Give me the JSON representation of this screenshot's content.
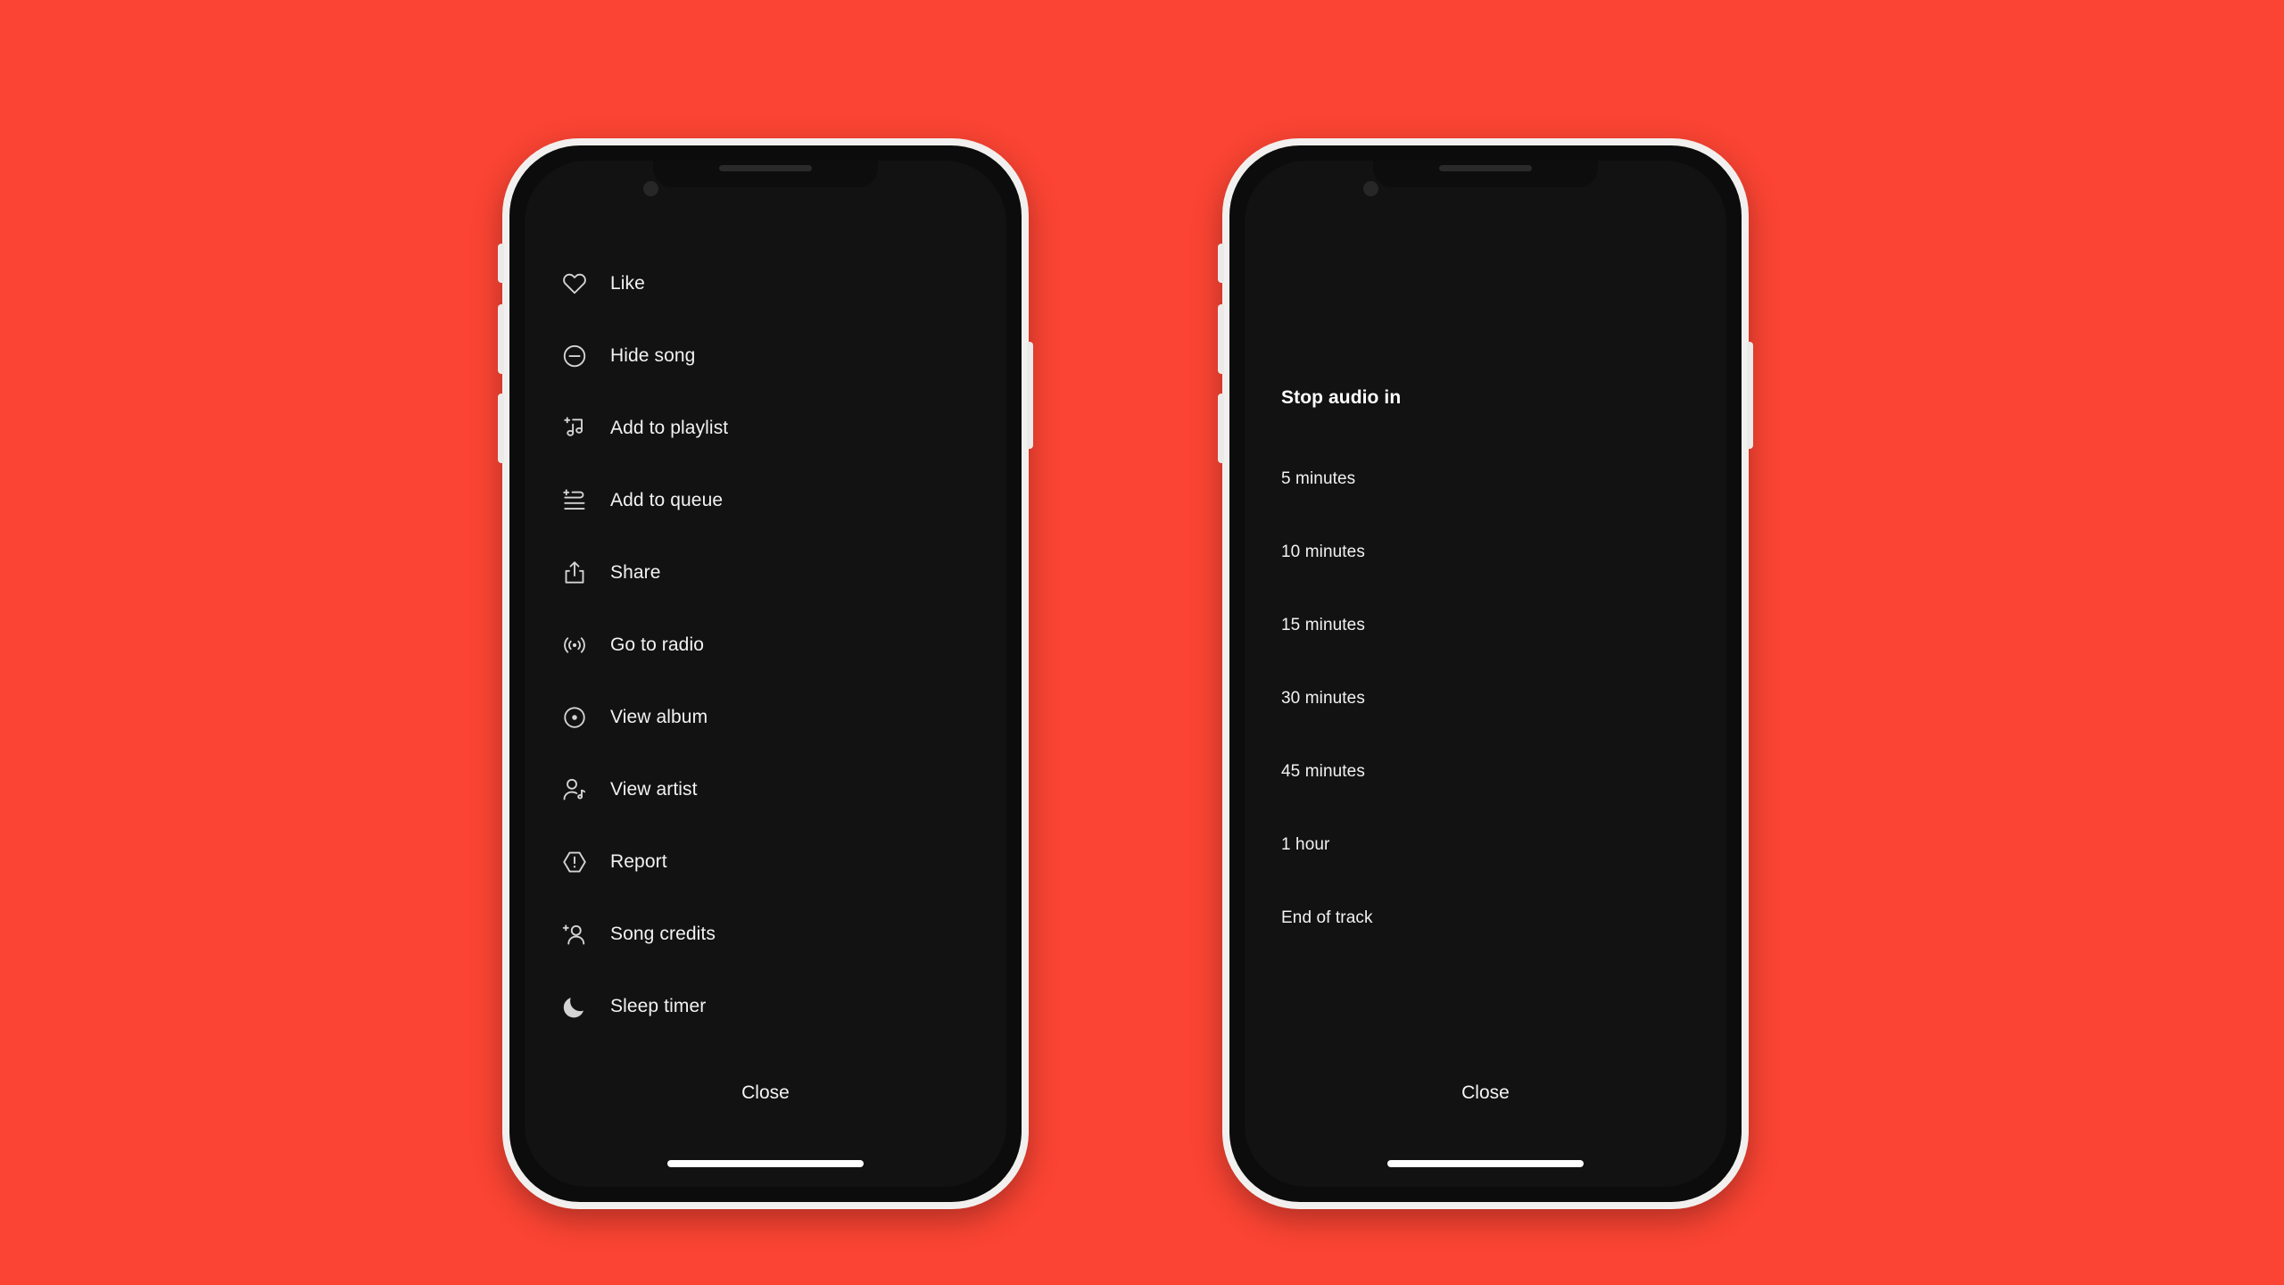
{
  "theme": {
    "background_color": "#fb4433",
    "screen_color": "#121212",
    "frame_color": "#f2f0ee",
    "text_color": "#f2f2f2"
  },
  "left_phone": {
    "menu": {
      "items": [
        {
          "label": "Like",
          "icon": "heart-icon"
        },
        {
          "label": "Hide song",
          "icon": "minus-circle-icon"
        },
        {
          "label": "Add to playlist",
          "icon": "music-note-plus-icon"
        },
        {
          "label": "Add to queue",
          "icon": "queue-plus-icon"
        },
        {
          "label": "Share",
          "icon": "share-icon"
        },
        {
          "label": "Go to radio",
          "icon": "radio-waves-icon"
        },
        {
          "label": "View album",
          "icon": "album-disc-icon"
        },
        {
          "label": "View artist",
          "icon": "artist-icon"
        },
        {
          "label": "Report",
          "icon": "report-octagon-icon"
        },
        {
          "label": "Song credits",
          "icon": "person-plus-icon"
        },
        {
          "label": "Sleep timer",
          "icon": "moon-icon"
        }
      ]
    },
    "close_label": "Close"
  },
  "right_phone": {
    "sleep_timer": {
      "title": "Stop audio in",
      "options": [
        {
          "label": "5 minutes"
        },
        {
          "label": "10 minutes"
        },
        {
          "label": "15 minutes"
        },
        {
          "label": "30 minutes"
        },
        {
          "label": "45 minutes"
        },
        {
          "label": "1 hour"
        },
        {
          "label": "End of track"
        }
      ]
    },
    "close_label": "Close"
  }
}
